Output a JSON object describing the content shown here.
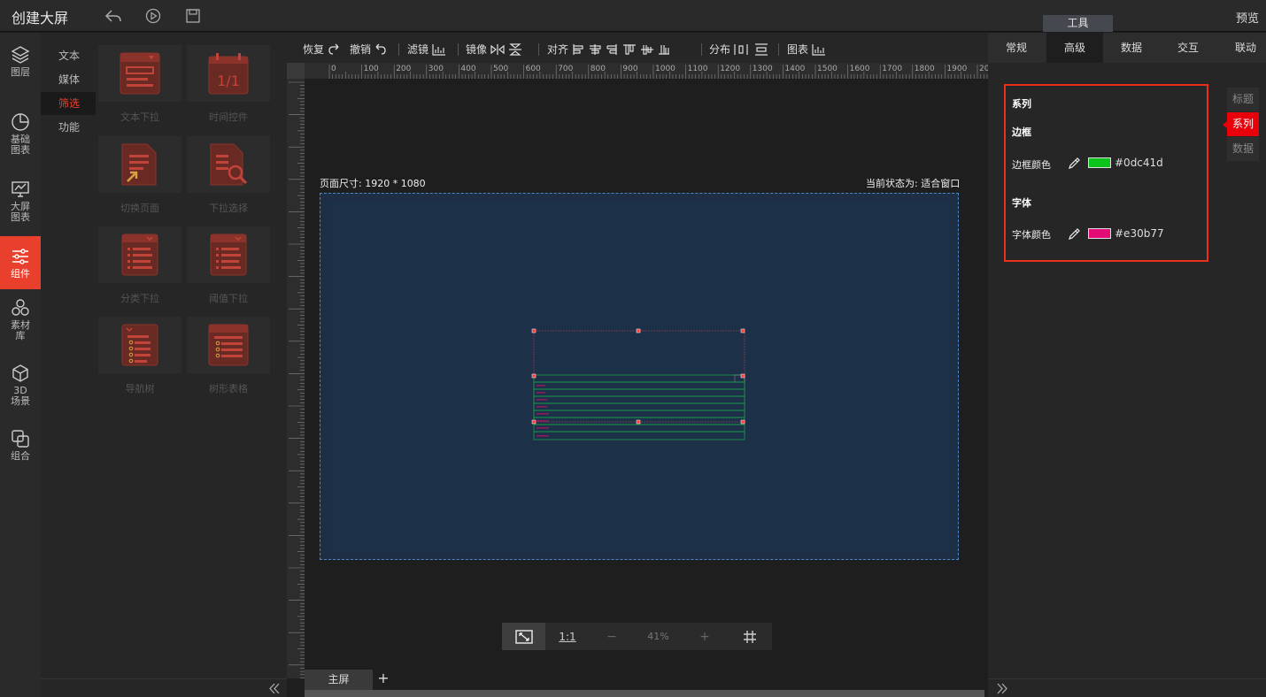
{
  "app": {
    "title": "创建大屏",
    "preview": "预览",
    "tools_tab": "工具"
  },
  "header_icons": [
    "undo-icon",
    "play-icon",
    "save-icon"
  ],
  "left_nav": [
    {
      "label": "图层",
      "icon": "layers-icon"
    },
    {
      "label": "基础\n图表",
      "icon": "pie-chart-icon"
    },
    {
      "label": "大屏\n图表",
      "icon": "monitor-chart-icon"
    },
    {
      "label": "组件",
      "icon": "sliders-icon",
      "active": true
    },
    {
      "label": "素材\n库",
      "icon": "hexagons-icon"
    },
    {
      "label": "3D\n场景",
      "icon": "cube-icon"
    },
    {
      "label": "组合",
      "icon": "group-icon"
    }
  ],
  "sub_nav": [
    {
      "label": "文本"
    },
    {
      "label": "媒体"
    },
    {
      "label": "筛选",
      "active": true
    },
    {
      "label": "功能"
    }
  ],
  "components": [
    {
      "label": "文本下拉",
      "icon": "text-dropdown-icon"
    },
    {
      "label": "时间控件",
      "icon": "calendar-icon",
      "glyph": "1/1"
    },
    {
      "label": "切换页面",
      "icon": "switch-page-icon"
    },
    {
      "label": "下拉选择",
      "icon": "dropdown-select-icon"
    },
    {
      "label": "分类下拉",
      "icon": "category-dropdown-icon"
    },
    {
      "label": "阈值下拉",
      "icon": "threshold-dropdown-icon"
    },
    {
      "label": "导航树",
      "icon": "nav-tree-icon"
    },
    {
      "label": "树形表格",
      "icon": "tree-table-icon"
    }
  ],
  "toolbar": {
    "restore": "恢复",
    "undo": "撤销",
    "filter": "滤镜",
    "mirror": "镜像",
    "align": "对齐",
    "distribute": "分布",
    "chart": "图表"
  },
  "ruler": {
    "ticks": [
      "0",
      "100",
      "200",
      "300",
      "400",
      "500",
      "600",
      "700",
      "800",
      "900",
      "1000",
      "1100",
      "1200",
      "1300",
      "1400",
      "1500",
      "1600",
      "1700",
      "1800",
      "1900",
      "20"
    ]
  },
  "canvas": {
    "page_size": "页面尺寸: 1920 * 1080",
    "state": "当前状态为: 适合窗口",
    "zoom": "41%",
    "one_to_one": "1:1",
    "minus": "−",
    "plus": "+",
    "screen_tab": "主屏",
    "add_screen": "+"
  },
  "right_panel": {
    "tabs": [
      "常规",
      "高级",
      "数据",
      "交互",
      "联动"
    ],
    "active_tab": "高级",
    "series_title": "系列",
    "border_title": "边框",
    "border_color_label": "边框颜色",
    "border_color": "#0dc41d",
    "font_title": "字体",
    "font_color_label": "字体颜色",
    "font_color": "#e30b77",
    "vtabs": [
      "标题",
      "系列",
      "数据"
    ],
    "active_vtab": "系列"
  },
  "colors": {
    "accent": "#e8402c",
    "highlight": "#e8301c"
  }
}
